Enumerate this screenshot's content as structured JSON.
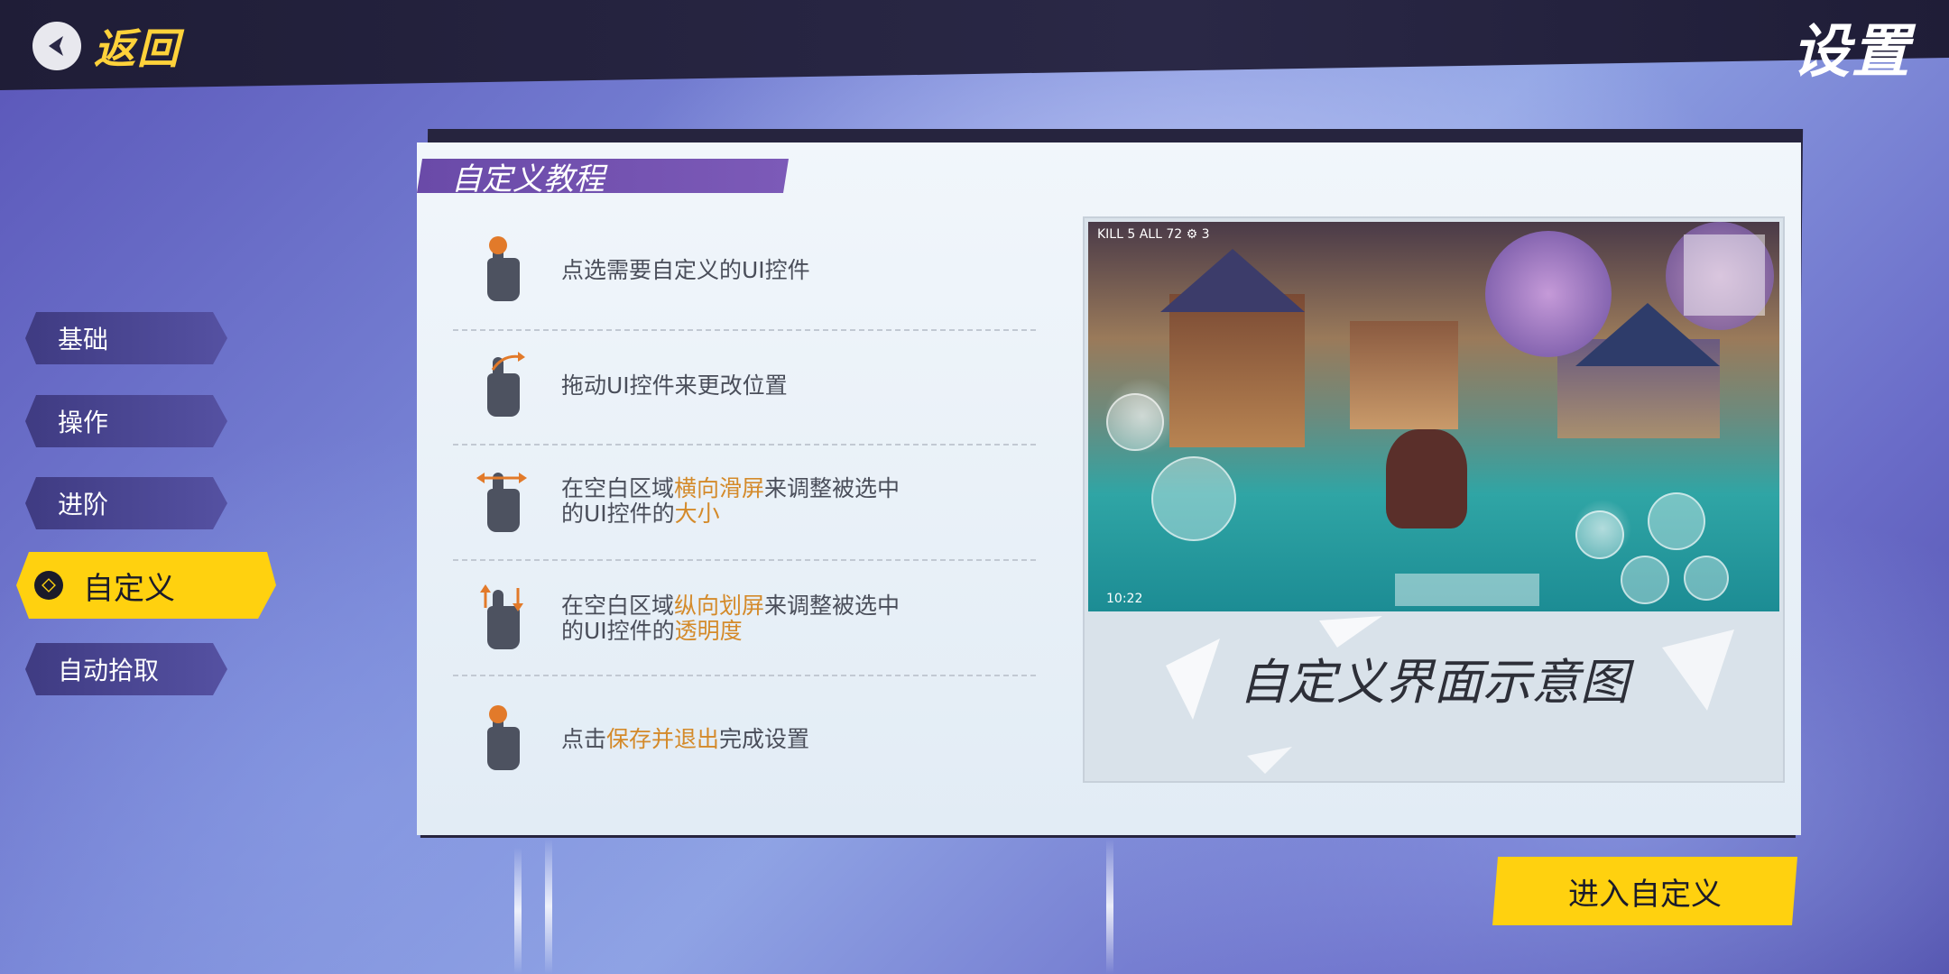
{
  "header": {
    "back_label": "返回",
    "title": "设置"
  },
  "nav": {
    "items": [
      {
        "label": "基础"
      },
      {
        "label": "操作"
      },
      {
        "label": "进阶"
      },
      {
        "label": "自定义",
        "active": true
      },
      {
        "label": "自动拾取"
      }
    ]
  },
  "panel": {
    "tab_title": "自定义教程",
    "steps": [
      {
        "icon": "tap-icon",
        "parts": [
          "点选需要自定义的UI控件"
        ]
      },
      {
        "icon": "drag-icon",
        "parts": [
          "拖动UI控件来更改位置"
        ]
      },
      {
        "icon": "swipe-horizontal-icon",
        "line1": [
          "在空白区域",
          "横向滑屏",
          "来调整被选中"
        ],
        "line2": [
          "的UI控件的",
          "大小"
        ]
      },
      {
        "icon": "swipe-vertical-icon",
        "line1": [
          "在空白区域",
          "纵向划屏",
          "来调整被选中"
        ],
        "line2": [
          "的UI控件的",
          "透明度"
        ]
      },
      {
        "icon": "tap-icon",
        "parts": [
          "点击",
          "保存并退出",
          "完成设置"
        ]
      }
    ],
    "preview": {
      "caption": "自定义界面示意图",
      "hud_top": "KILL 5  ALL 72  ⚙ 3",
      "hud_time": "10:22"
    }
  },
  "enter_button": "进入自定义",
  "colors": {
    "accent_yellow": "#ffd10f",
    "highlight_orange": "#d48a2a",
    "tab_purple": "#6a4aa8"
  }
}
